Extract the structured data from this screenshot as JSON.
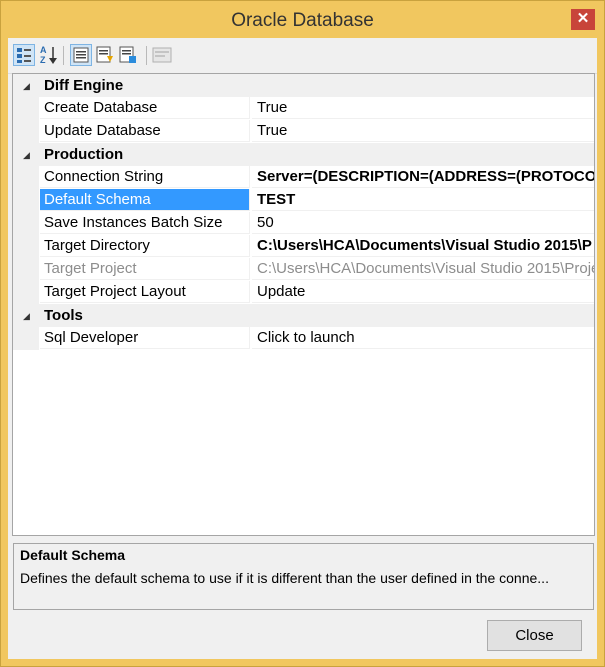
{
  "window": {
    "title": "Oracle Database"
  },
  "toolbar": {
    "buttons": [
      {
        "name": "categorized-icon"
      },
      {
        "name": "alphabetical-icon"
      },
      {
        "name": "properties-icon"
      },
      {
        "name": "events-icon"
      },
      {
        "name": "property-pages-icon"
      },
      {
        "name": "property-pages-disabled-icon"
      }
    ]
  },
  "grid": {
    "categories": [
      {
        "label": "Diff Engine",
        "rows": [
          {
            "name": "Create Database",
            "value": "True"
          },
          {
            "name": "Update Database",
            "value": "True"
          }
        ]
      },
      {
        "label": "Production",
        "rows": [
          {
            "name": "Connection String",
            "value": "Server=(DESCRIPTION=(ADDRESS=(PROTOCOL"
          },
          {
            "name": "Default Schema",
            "value": "TEST"
          },
          {
            "name": "Save Instances Batch Size",
            "value": "50"
          },
          {
            "name": "Target Directory",
            "value": "C:\\Users\\HCA\\Documents\\Visual Studio 2015\\P"
          },
          {
            "name": "Target Project",
            "value": "C:\\Users\\HCA\\Documents\\Visual Studio 2015\\Proje"
          },
          {
            "name": "Target Project Layout",
            "value": "Update"
          }
        ]
      },
      {
        "label": "Tools",
        "rows": [
          {
            "name": "Sql Developer",
            "value": "Click to launch"
          }
        ]
      }
    ]
  },
  "description": {
    "title": "Default Schema",
    "text": "Defines the default schema to use if it is different than the user defined in the conne..."
  },
  "footer": {
    "close_label": "Close"
  },
  "colors": {
    "accent": "#3399ff",
    "frame": "#f1c75f",
    "close": "#c8453a"
  }
}
